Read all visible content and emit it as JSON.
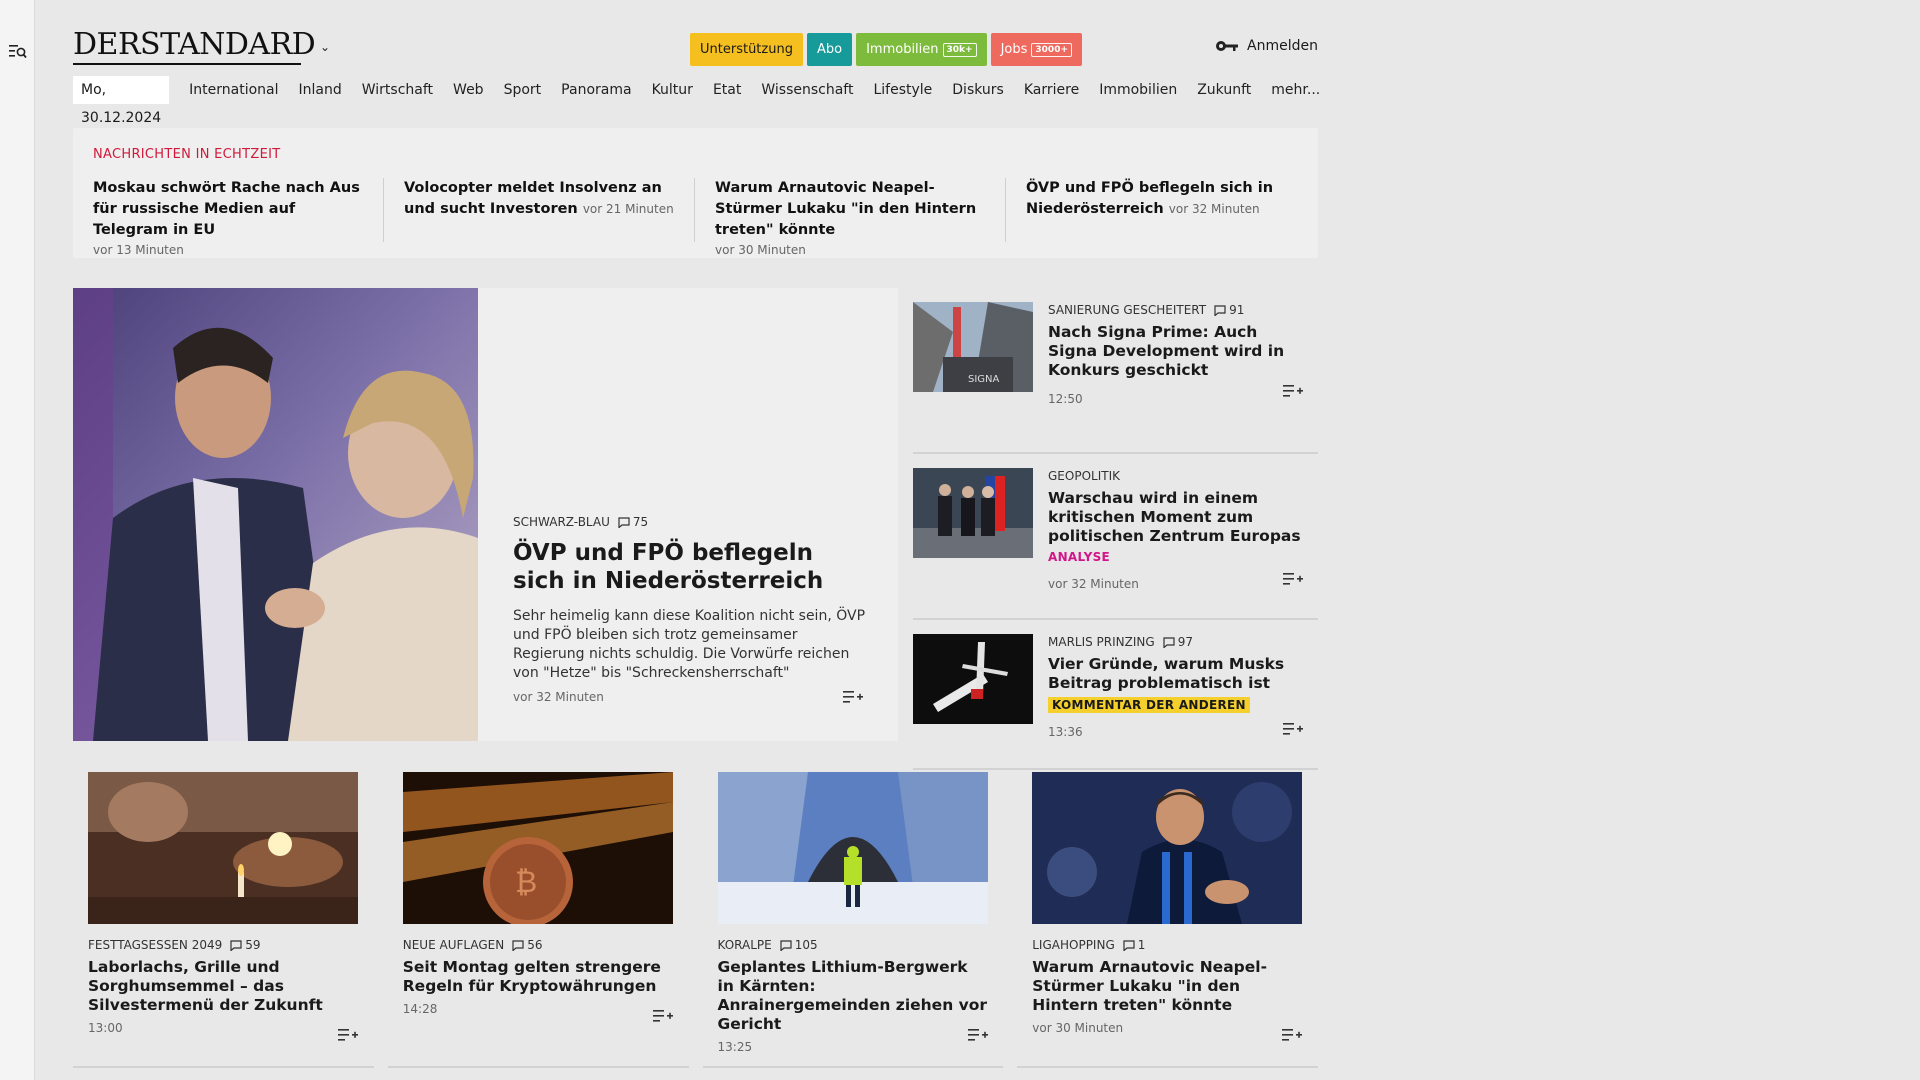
{
  "header": {
    "logo": "DERSTANDARD",
    "pills": [
      {
        "label": "Unterstützung",
        "tag": ""
      },
      {
        "label": "Abo",
        "tag": ""
      },
      {
        "label": "Immobilien",
        "tag": "30k+"
      },
      {
        "label": "Jobs",
        "tag": "3000+"
      }
    ],
    "login": "Anmelden"
  },
  "nav": {
    "date": "Mo, 30.12.2024",
    "items": [
      "International",
      "Inland",
      "Wirtschaft",
      "Web",
      "Sport",
      "Panorama",
      "Kultur",
      "Etat",
      "Wissenschaft",
      "Lifestyle",
      "Diskurs",
      "Karriere",
      "Immobilien",
      "Zukunft",
      "mehr..."
    ]
  },
  "ticker": {
    "heading": "NACHRICHTEN IN ECHTZEIT",
    "items": [
      {
        "title": "Moskau schwört Rache nach Aus für russische Medien auf Telegram in EU",
        "time": "vor 13 Minuten"
      },
      {
        "title": "Volocopter meldet Insolvenz an und sucht Investoren",
        "time": "vor 21 Minuten"
      },
      {
        "title": "Warum Arnautovic Neapel-Stürmer Lukaku \"in den Hintern treten\" könnte",
        "time": "vor 30 Minuten"
      },
      {
        "title": "ÖVP und FPÖ beflegeln sich in Nieder­österreich",
        "time": "vor 32 Minuten"
      }
    ]
  },
  "lead": {
    "kicker": "SCHWARZ-BLAU",
    "comments": "75",
    "title": "ÖVP und FPÖ beflegeln sich in Niederösterreich",
    "teaser": "Sehr heimelig kann diese Koalition nicht sein, ÖVP und FPÖ bleiben sich trotz gemeinsamer Regierung nichts schuldig. Die Vorwürfe reichen von \"Hetze\" bis \"Schreckensherrschaft\"",
    "time": "vor 32 Minuten"
  },
  "side": [
    {
      "kicker": "SANIERUNG GESCHEITERT",
      "comments": "91",
      "title": "Nach Signa Prime: Auch Signa Development wird in Konkurs geschickt",
      "label": "",
      "time": "12:50"
    },
    {
      "kicker": "GEOPOLITIK",
      "comments": "",
      "title": "Warschau wird in einem kritischen Moment zum politischen Zentrum Europas",
      "label": "ANALYSE",
      "time": "vor 32 Minuten"
    },
    {
      "kicker": "MARLIS PRINZING",
      "comments": "97",
      "title": "Vier Gründe, warum Musks Beitrag problematisch ist",
      "label": "KOMMENTAR DER ANDEREN",
      "time": "13:36"
    }
  ],
  "cards": [
    {
      "kicker": "FESTTAGSESSEN 2049",
      "comments": "59",
      "title": "Laborlachs, Grille und Sorghumsemmel – das Silvestermenü der Zukunft",
      "time": "13:00"
    },
    {
      "kicker": "NEUE AUFLAGEN",
      "comments": "56",
      "title": "Seit Montag gelten strengere Regeln für Kryptowährungen",
      "time": "14:28"
    },
    {
      "kicker": "KORALPE",
      "comments": "105",
      "title": "Geplantes Lithium-Bergwerk in Kärnten: Anrainergemeinden ziehen vor Gericht",
      "time": "13:25"
    },
    {
      "kicker": "LIGAHOPPING",
      "comments": "1",
      "title": "Warum Arnautovic Neapel-Stürmer Lukaku \"in den Hintern treten\" könnte",
      "time": "vor 30 Minuten"
    }
  ],
  "colors": {
    "ticker_heading": "#d0193a",
    "analyse": "#d3158a",
    "kommentar_bg": "#f5cf2b"
  },
  "icons": {
    "menu": "menu-search-icon",
    "login": "key-icon",
    "comments": "comment-icon",
    "save": "add-to-list-icon"
  }
}
